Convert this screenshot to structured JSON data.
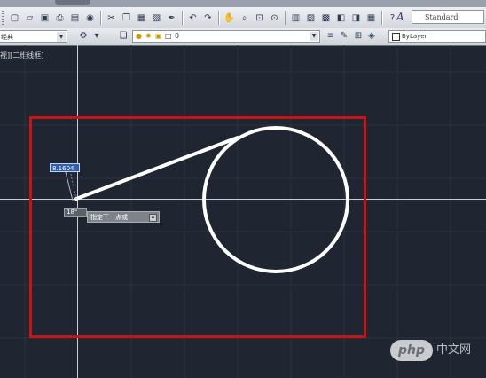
{
  "toolbar": {
    "icons": [
      "new-icon",
      "open-icon",
      "save-icon",
      "print-icon",
      "preview-icon",
      "publish-icon",
      "cut-icon",
      "copy-icon",
      "paste-icon",
      "match-icon",
      "brush-icon",
      "undo-icon",
      "redo-icon",
      "pan-icon",
      "zoom-realtime-icon",
      "zoom-window-icon",
      "zoom-previous-icon",
      "properties-icon",
      "design-center-icon",
      "tool-palettes-icon",
      "sheet-set-icon",
      "markup-icon",
      "calc-icon",
      "help-icon"
    ],
    "text_style": "Standard"
  },
  "layer_toolbar": {
    "workspace_partial": "经典",
    "color_control": "ByLayer"
  },
  "viewport": {
    "label": "视][二维线框]"
  },
  "tooltip": {
    "length_value": "8.1604",
    "angle_value": "18°",
    "prompt": "指定下一点或"
  },
  "watermark": {
    "logo": "php",
    "text": "中文网"
  },
  "colors": {
    "background": "#1f2531",
    "selection_rect": "#c81414",
    "geometry": "#ffffff",
    "crosshair": "#c9ccd2"
  }
}
